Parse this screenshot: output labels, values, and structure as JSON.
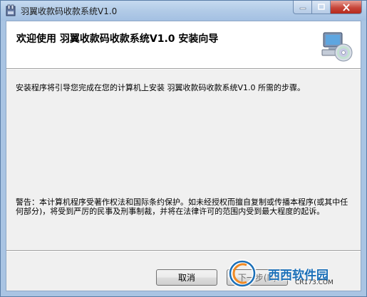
{
  "window": {
    "title": "羽翼收款码收款系统V1.0",
    "controls": {
      "minimize": "—",
      "maximize": "□",
      "close": "✕"
    }
  },
  "banner": {
    "title": "欢迎使用 羽翼收款码收款系统V1.0 安装向导",
    "icon": "computer-cd-icon"
  },
  "body": {
    "intro": "安装程序将引导您完成在您的计算机上安装 羽翼收款码收款系统V1.0 所需的步骤。",
    "warning": "警告：本计算机程序受著作权法和国际条约保护。如未经授权而擅自复制或传播本程序(或其中任何部分)，将受到严厉的民事及刑事制裁，并将在法律许可的范围内受到最大程度的起诉。"
  },
  "buttons": {
    "cancel": "取消",
    "next": "下一步(N)"
  },
  "watermark": {
    "brand": "西西软件园",
    "url": "CR173.COM"
  },
  "colors": {
    "frame": "#a9c4e3",
    "client_bg": "#f0f0f0",
    "banner_bg": "#ffffff",
    "close_button": "#c7463a",
    "watermark_blue": "#1a6fb8"
  }
}
